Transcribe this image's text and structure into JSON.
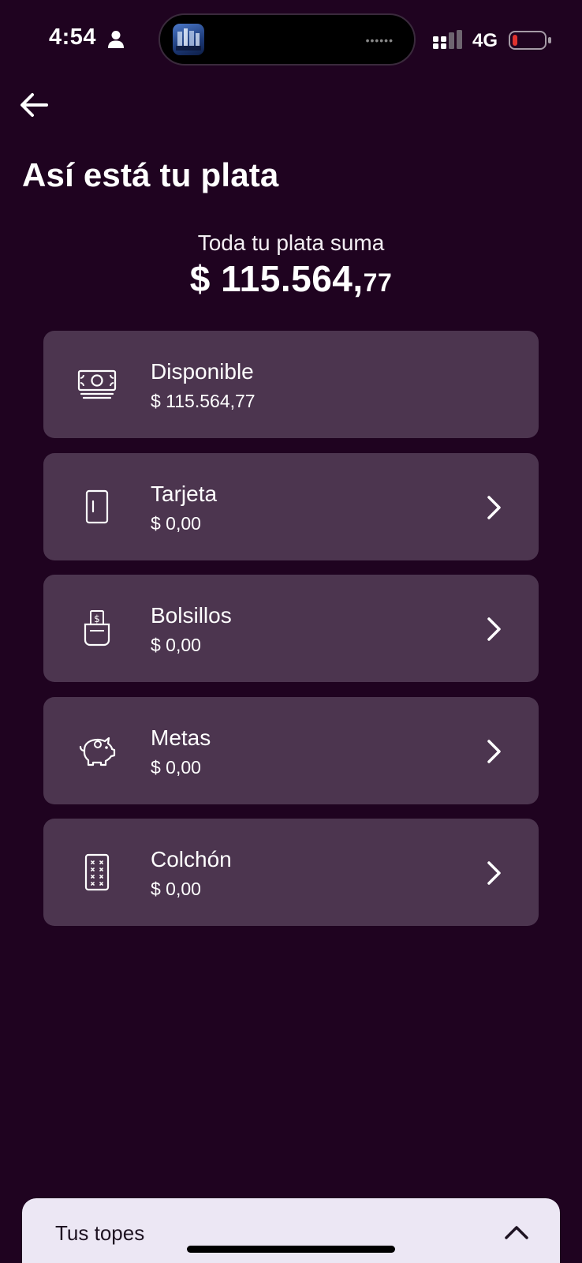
{
  "status_bar": {
    "time": "4:54",
    "network": "4G",
    "battery_color": "#e0322e"
  },
  "header": {
    "back_icon": "arrow-left-icon",
    "title": "Así está tu plata"
  },
  "summary": {
    "label": "Toda tu plata suma",
    "amount_main": "$ 115.564,",
    "amount_decimals": "77"
  },
  "accounts": [
    {
      "name": "Disponible",
      "amount": "$ 115.564,77",
      "icon": "cash-icon",
      "has_chevron": false
    },
    {
      "name": "Tarjeta",
      "amount": "$ 0,00",
      "icon": "card-icon",
      "has_chevron": true
    },
    {
      "name": "Bolsillos",
      "amount": "$ 0,00",
      "icon": "pocket-icon",
      "has_chevron": true
    },
    {
      "name": "Metas",
      "amount": "$ 0,00",
      "icon": "piggy-bank-icon",
      "has_chevron": true
    },
    {
      "name": "Colchón",
      "amount": "$ 0,00",
      "icon": "mattress-icon",
      "has_chevron": true
    }
  ],
  "bottom_sheet": {
    "title": "Tus topes",
    "icon": "chevron-up-icon"
  },
  "colors": {
    "background": "#1f0320",
    "card": "#4c354f",
    "sheet": "#ece7f4"
  }
}
